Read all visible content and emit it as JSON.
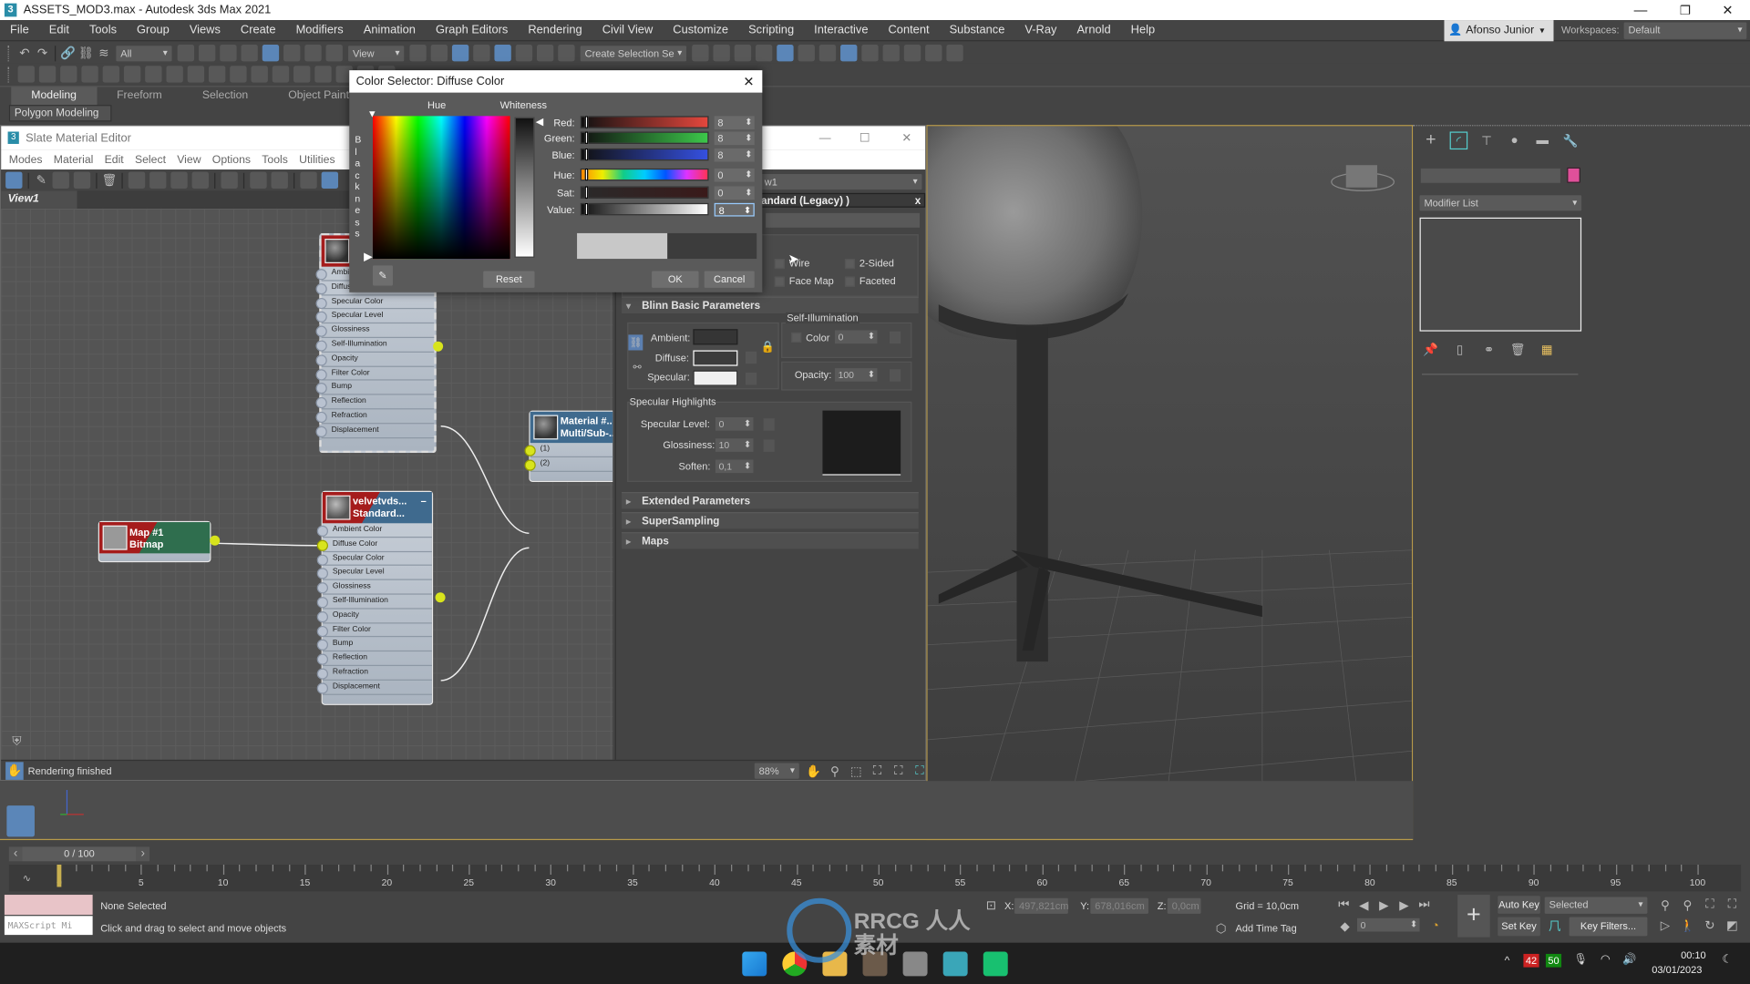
{
  "window": {
    "title": "ASSETS_MOD3.max - Autodesk 3ds Max 2021",
    "icon": "3",
    "controls": [
      "minimize",
      "maximize",
      "close"
    ]
  },
  "menu": [
    "File",
    "Edit",
    "Tools",
    "Group",
    "Views",
    "Create",
    "Modifiers",
    "Animation",
    "Graph Editors",
    "Rendering",
    "Civil View",
    "Customize",
    "Scripting",
    "Interactive",
    "Content",
    "Substance",
    "V-Ray",
    "Arnold",
    "Help"
  ],
  "user": {
    "name": "Afonso Junior"
  },
  "workspaces": {
    "label": "Workspaces:",
    "value": "Default"
  },
  "toolbar": {
    "selection_filter": "All",
    "ref_coord": "View",
    "named_selection": "Create Selection Se"
  },
  "ribbon": {
    "tabs": [
      "Modeling",
      "Freeform",
      "Selection",
      "Object Paint"
    ],
    "active_tab": "Modeling",
    "panel": "Polygon Modeling"
  },
  "slate": {
    "title": "Slate Material Editor",
    "menu": [
      "Modes",
      "Material",
      "Edit",
      "Select",
      "View",
      "Options",
      "Tools",
      "Utilities"
    ],
    "view_tab": "View1",
    "status": "Rendering finished",
    "zoom": "88%",
    "nodes": {
      "top_material": {
        "slots": [
          "Ambient Color",
          "Diffuse Color",
          "Specular Color",
          "Specular Level",
          "Glossiness",
          "Self-Illumination",
          "Opacity",
          "Filter Color",
          "Bump",
          "Reflection",
          "Refraction",
          "Displacement"
        ]
      },
      "velvet": {
        "name": "velvetvds...",
        "type": "Standard...",
        "slots": [
          "Ambient Color",
          "Diffuse Color",
          "Specular Color",
          "Specular Level",
          "Glossiness",
          "Self-Illumination",
          "Opacity",
          "Filter Color",
          "Bump",
          "Reflection",
          "Refraction",
          "Displacement"
        ]
      },
      "map": {
        "name": "Map #1",
        "type": "Bitmap"
      },
      "multi": {
        "name": "Material #..",
        "type": "Multi/Sub-..",
        "slots": [
          "(1)",
          "(2)"
        ]
      }
    },
    "params": {
      "view_dropdown": "w1",
      "material_title": "andard (Legacy) )",
      "shader": {
        "wire": "Wire",
        "two_sided": "2-Sided",
        "face_map": "Face Map",
        "faceted": "Faceted"
      },
      "blinn": {
        "title": "Blinn Basic Parameters",
        "ambient": "Ambient:",
        "diffuse": "Diffuse:",
        "specular": "Specular:",
        "self_illum_title": "Self-Illumination",
        "self_illum_color": "Color",
        "self_illum_value": "0",
        "opacity_label": "Opacity:",
        "opacity": "100",
        "spec_title": "Specular Highlights",
        "spec_level_label": "Specular Level:",
        "spec_level": "0",
        "gloss_label": "Glossiness:",
        "gloss": "10",
        "soften_label": "Soften:",
        "soften": "0,1",
        "ambient_color": "#353535",
        "diffuse_color": "#3c3c3c",
        "specular_color": "#f0f0f0"
      },
      "rollouts": [
        "Extended Parameters",
        "SuperSampling",
        "Maps"
      ]
    }
  },
  "color_selector": {
    "title": "Color Selector: Diffuse Color",
    "hue_label": "Hue",
    "whiteness_label": "Whiteness",
    "blackness_label": "Blackness",
    "channels": [
      {
        "label": "Red:",
        "value": "8"
      },
      {
        "label": "Green:",
        "value": "8"
      },
      {
        "label": "Blue:",
        "value": "8"
      },
      {
        "label": "Hue:",
        "value": "0"
      },
      {
        "label": "Sat:",
        "value": "0"
      },
      {
        "label": "Value:",
        "value": "8"
      }
    ],
    "new_color": "#c8c8c8",
    "old_color": "#3c3c3c",
    "reset": "Reset",
    "ok": "OK",
    "cancel": "Cancel"
  },
  "command_panel": {
    "modifier_list": "Modifier List",
    "object_color": "#e0509a"
  },
  "timeline": {
    "slider": "0 / 100",
    "ruler_labels": [
      "0",
      "5",
      "10",
      "15",
      "20",
      "25",
      "30",
      "35",
      "40",
      "45",
      "50",
      "55",
      "60",
      "65",
      "70",
      "75",
      "80",
      "85",
      "90",
      "95",
      "100"
    ],
    "current_frame": 0
  },
  "status": {
    "selection": "None Selected",
    "prompt": "Click and drag to select and move objects",
    "maxscript": "MAXScript Mi",
    "x_label": "X:",
    "x": "497,821cm",
    "y_label": "Y:",
    "y": "678,016cm",
    "z_label": "Z:",
    "z": "0,0cm",
    "grid": "Grid = 10,0cm",
    "add_time_tag": "Add Time Tag",
    "frame": "0",
    "auto_key": "Auto Key",
    "set_key": "Set Key",
    "key_mode": "Selected",
    "key_filters": "Key Filters..."
  },
  "taskbar": {
    "tray_badge_red": "42",
    "tray_badge_green": "50",
    "time": "00:10",
    "date": "03/01/2023"
  },
  "watermark": "RRCG 人人素材"
}
